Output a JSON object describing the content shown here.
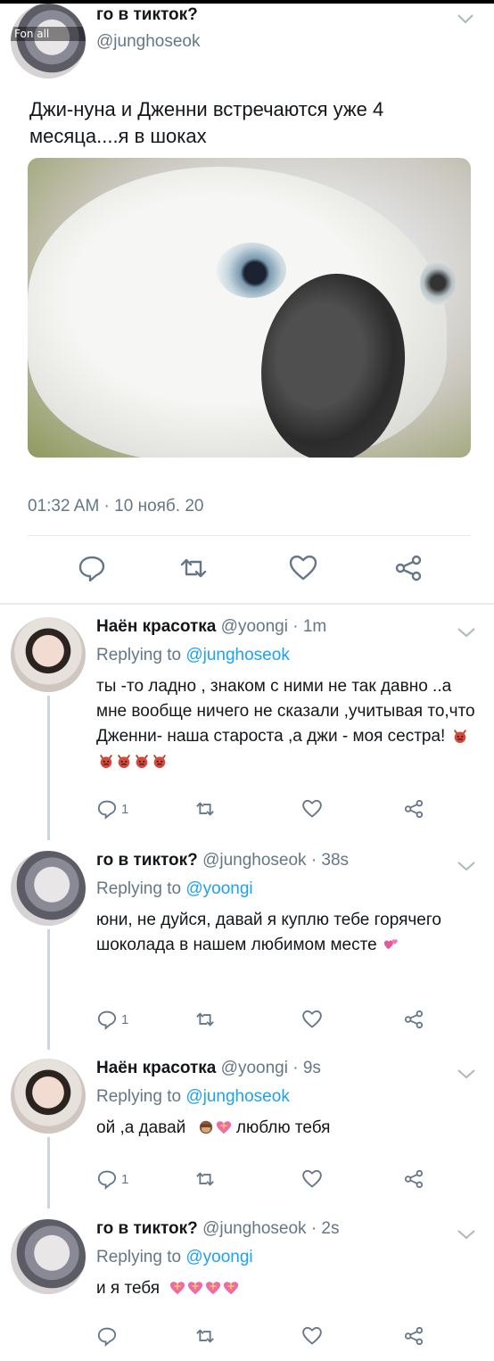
{
  "main_tweet": {
    "avatar_label": "Fon all",
    "name": "го в тикток?",
    "handle": "@junghoseok",
    "text": "Джи-нуна и Дженни встречаются уже 4 месяца....я в шоках",
    "timestamp": "01:32 AM · 10 нояб. 20",
    "icons": [
      "reply-icon",
      "retweet-icon",
      "like-icon",
      "share-icon"
    ]
  },
  "replies": [
    {
      "name": "Наён красотка",
      "meta": "@yoongi · 1m",
      "replying_prefix": "Replying to",
      "replying_to": "@junghoseok",
      "text": "ты -то ладно , знаком с ними не так давно ..а мне вообще ничего не сказали ,учитывая то,что Дженни- наша староста ,а джи - моя сестра!",
      "emoji": [
        "devil",
        "devil",
        "devil",
        "devil",
        "devil"
      ],
      "reply_count": "1"
    },
    {
      "name": "го в тикток?",
      "meta": "@junghoseok · 38s",
      "replying_prefix": "Replying to",
      "replying_to": "@yoongi",
      "text": "юни, не дуйся, давай я куплю тебе горячего шоколада в нашем любимом месте",
      "emoji": [
        "two-hearts"
      ],
      "reply_count": "1"
    },
    {
      "name": "Наён красотка",
      "meta": "@yoongi · 9s",
      "replying_prefix": "Replying to",
      "replying_to": "@junghoseok",
      "text_a": "ой ,а давай",
      "text_b": "люблю тебя",
      "emoji": [
        "see-no-evil-monkey",
        "heart-with-ribbon"
      ],
      "reply_count": "1"
    },
    {
      "name": "го в тикток?",
      "meta": "@junghoseok · 2s",
      "replying_prefix": "Replying to",
      "replying_to": "@yoongi",
      "text": "и я тебя",
      "emoji": [
        "heart-with-ribbon",
        "heart-with-ribbon",
        "heart-with-ribbon",
        "heart-with-ribbon"
      ],
      "reply_count": ""
    }
  ],
  "colors": {
    "text": "#14171a",
    "secondary": "#657786",
    "link": "#1da1f2",
    "divider": "#e6ecf0",
    "thread": "#ccd6dd"
  }
}
